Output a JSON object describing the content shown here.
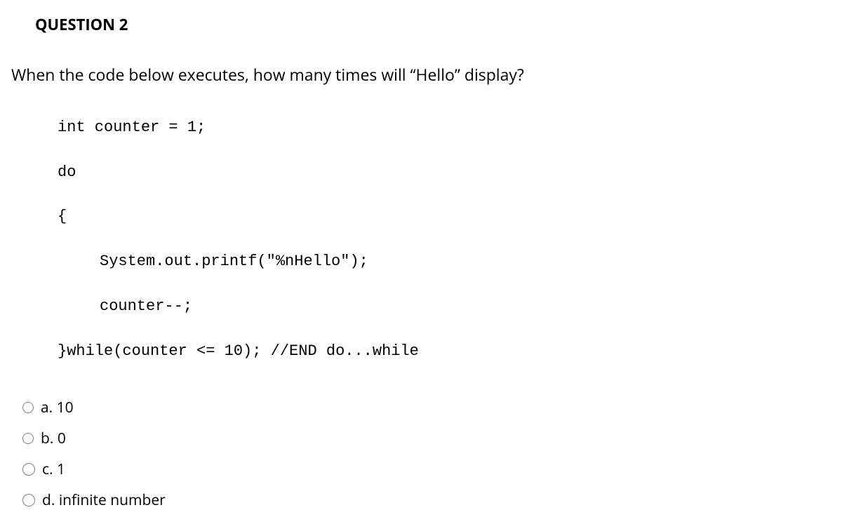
{
  "header": "QUESTION 2",
  "question": "When the code below executes, how many times will “Hello” display?",
  "code": {
    "line1": "int counter = 1;",
    "line2": "do",
    "line3": "{",
    "line4": "System.out.printf(\"%nHello\");",
    "line5": "counter--;",
    "line6": "}while(counter <= 10); //END do...while"
  },
  "options": [
    {
      "label": "a. 10"
    },
    {
      "label": "b. 0"
    },
    {
      "label": "c. 1"
    },
    {
      "label": "d. infinite number"
    }
  ]
}
